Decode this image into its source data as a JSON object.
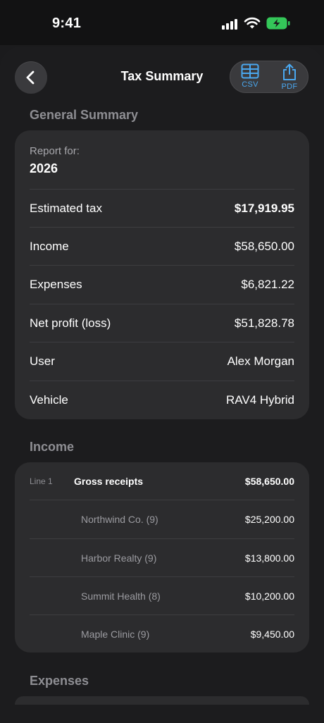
{
  "status_bar": {
    "time": "9:41"
  },
  "nav": {
    "title": "Tax Summary",
    "export_csv_label": "CSV",
    "export_pdf_label": "PDF"
  },
  "general_summary": {
    "section_title": "General Summary",
    "report_for_label": "Report for:",
    "report_year": "2026",
    "rows": [
      {
        "label": "Estimated tax",
        "value": "$17,919.95"
      },
      {
        "label": "Income",
        "value": "$58,650.00"
      },
      {
        "label": "Expenses",
        "value": "$6,821.22"
      },
      {
        "label": "Net profit (loss)",
        "value": "$51,828.78"
      },
      {
        "label": "User",
        "value": "Alex Morgan"
      },
      {
        "label": "Vehicle",
        "value": "RAV4 Hybrid"
      }
    ]
  },
  "income": {
    "section_title": "Income",
    "line_number": "Line 1",
    "line_label": "Gross receipts",
    "line_value": "$58,650.00",
    "sources": [
      {
        "label": "Northwind Co. (9)",
        "value": "$25,200.00"
      },
      {
        "label": "Harbor Realty (9)",
        "value": "$13,800.00"
      },
      {
        "label": "Summit Health (8)",
        "value": "$10,200.00"
      },
      {
        "label": "Maple Clinic (9)",
        "value": "$9,450.00"
      }
    ]
  },
  "expenses": {
    "section_title": "Expenses"
  },
  "colors": {
    "background": "#1c1c1e",
    "card": "#2c2c2e",
    "accent": "#4aa8f0",
    "battery_green": "#34c759"
  }
}
